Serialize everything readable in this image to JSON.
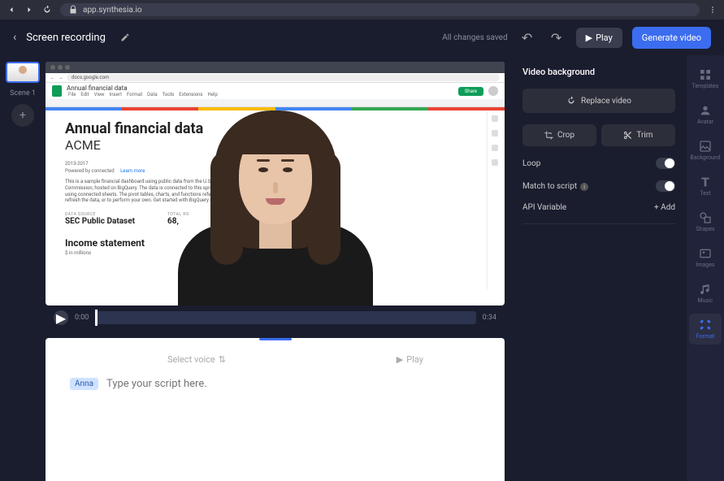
{
  "browser": {
    "url": "app.synthesia.io"
  },
  "header": {
    "title": "Screen recording",
    "saved": "All changes saved",
    "play": "Play",
    "generate": "Generate video"
  },
  "scenes": {
    "label": "Scene 1"
  },
  "doc": {
    "url_text": "docs.google.com",
    "sheets_title": "Annual financial data",
    "menus": [
      "File",
      "Edit",
      "View",
      "Insert",
      "Format",
      "Data",
      "Tools",
      "Extensions",
      "Help"
    ],
    "share": "Share",
    "h1": "Annual financial data",
    "h2": "ACME",
    "years": "2013-2017",
    "powered": "Powered by connected",
    "learn": "Learn more",
    "para": "This is a sample financial dashboard using public data from the U.S. Securities Commission, hosted on BigQuery. The data is connected to this spreadsheet the bottom using connected sheets. The pivot tables, charts, and functions reference that data. To refresh the data, or to perform your own. Get started with BigQuery data in Google Sheets",
    "src_label": "DATA SOURCE",
    "src_val": "SEC Public Dataset",
    "rows_label": "TOTAL RO",
    "rows_val": "68,",
    "h3": "Income statement",
    "sub": "$ in millions"
  },
  "playback": {
    "start": "0:00",
    "end": "0:34"
  },
  "script": {
    "voice": "Select voice",
    "play": "Play",
    "name": "Anna",
    "placeholder": "Type your script here."
  },
  "props": {
    "title": "Video background",
    "replace": "Replace video",
    "crop": "Crop",
    "trim": "Trim",
    "loop": "Loop",
    "match": "Match to script",
    "api": "API Variable",
    "add": "+ Add"
  },
  "rail": {
    "templates": "Templates",
    "avatar": "Avatar",
    "background": "Background",
    "text": "Text",
    "shapes": "Shapes",
    "images": "Images",
    "music": "Music",
    "format": "Format"
  }
}
